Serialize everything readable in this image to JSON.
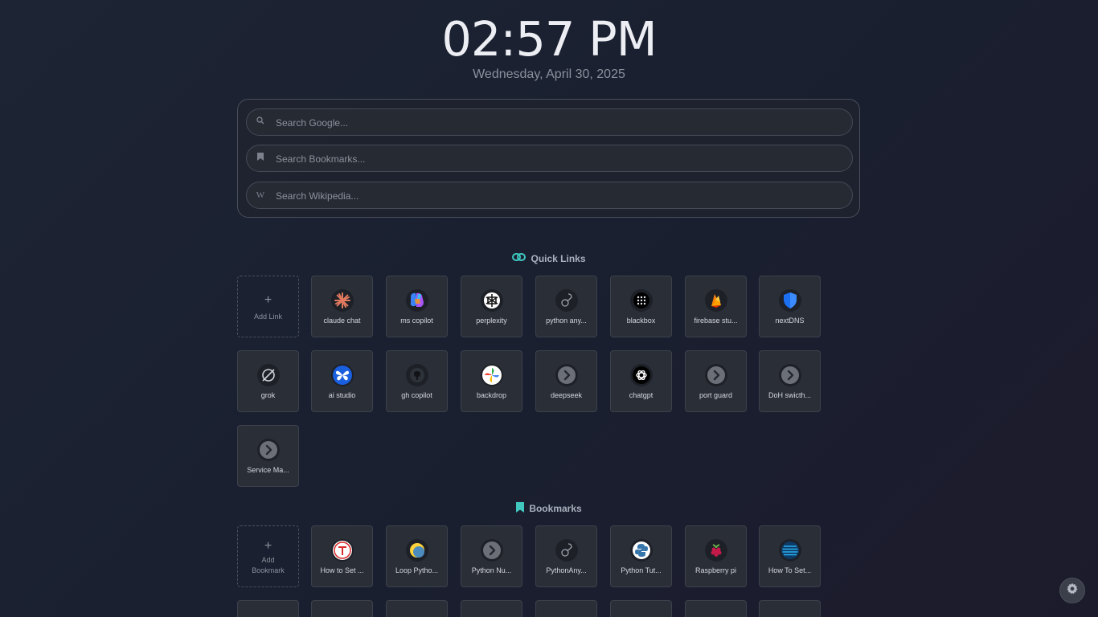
{
  "clock": {
    "time": "02:57 PM",
    "date": "Wednesday, April 30, 2025"
  },
  "search": {
    "google_placeholder": "Search Google...",
    "bookmarks_placeholder": "Search Bookmarks...",
    "wikipedia_placeholder": "Search Wikipedia..."
  },
  "quick_links": {
    "title": "Quick Links",
    "add_label": "Add Link",
    "items": [
      {
        "label": "claude chat",
        "icon": "claude-icon"
      },
      {
        "label": "ms copilot",
        "icon": "copilot-icon"
      },
      {
        "label": "perplexity",
        "icon": "perplexity-icon"
      },
      {
        "label": "python any...",
        "icon": "pythonanywhere-icon"
      },
      {
        "label": "blackbox",
        "icon": "blackbox-icon"
      },
      {
        "label": "firebase stu...",
        "icon": "firebase-icon"
      },
      {
        "label": "nextDNS",
        "icon": "shield-icon"
      },
      {
        "label": "grok",
        "icon": "grok-icon"
      },
      {
        "label": "ai studio",
        "icon": "butterfly-icon"
      },
      {
        "label": "gh copilot",
        "icon": "github-icon"
      },
      {
        "label": "backdrop",
        "icon": "pinwheel-icon"
      },
      {
        "label": "deepseek",
        "icon": "chevron-right-icon"
      },
      {
        "label": "chatgpt",
        "icon": "openai-icon"
      },
      {
        "label": "port guard",
        "icon": "chevron-right-icon"
      },
      {
        "label": "DoH swicth...",
        "icon": "chevron-right-icon"
      },
      {
        "label": "Service Ma...",
        "icon": "chevron-right-icon"
      }
    ]
  },
  "bookmarks": {
    "title": "Bookmarks",
    "add_label_line1": "Add",
    "add_label_line2": "Bookmark",
    "items": [
      {
        "label": "How to Set ...",
        "icon": "red-t-icon"
      },
      {
        "label": "Loop Pytho...",
        "icon": "python-yellow-icon"
      },
      {
        "label": "Python Nu...",
        "icon": "chevron-right-icon"
      },
      {
        "label": "PythonAny...",
        "icon": "pythonanywhere-icon"
      },
      {
        "label": "Python Tut...",
        "icon": "python-icon"
      },
      {
        "label": "Raspberry pi",
        "icon": "raspberry-icon"
      },
      {
        "label": "How To Set...",
        "icon": "globe-icon"
      }
    ]
  },
  "colors": {
    "accent": "#3fc7c0",
    "background": "#1d2433"
  }
}
